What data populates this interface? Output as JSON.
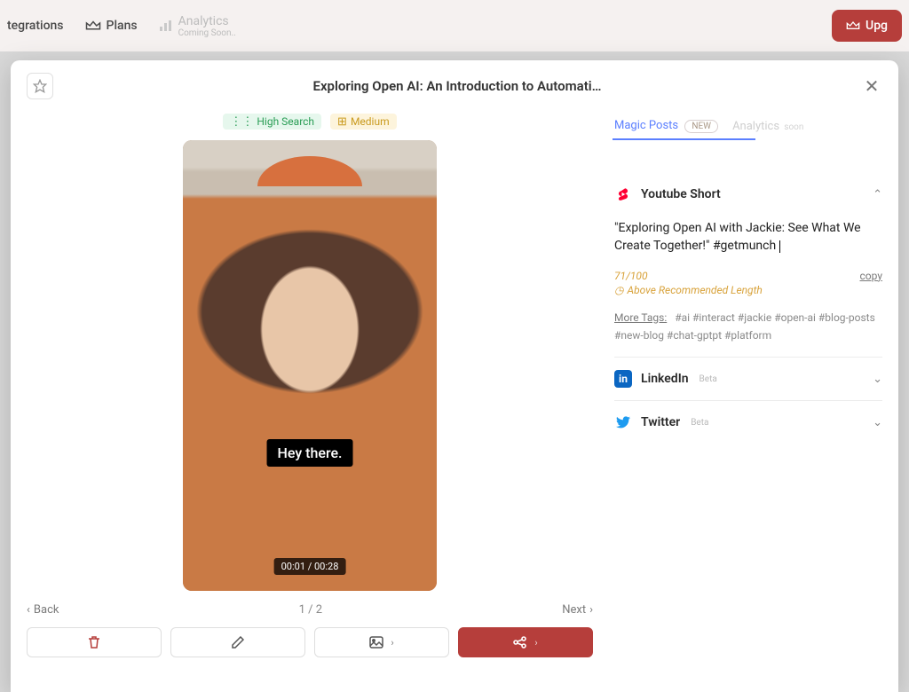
{
  "nav": {
    "integrations": "tegrations",
    "plans": "Plans",
    "analytics": "Analytics",
    "analytics_sub": "Coming Soon..",
    "upgrade": "Upg"
  },
  "modal": {
    "title": "Exploring Open AI: An Introduction to Automati…"
  },
  "badges": {
    "search": "High Search",
    "medium": "Medium"
  },
  "video": {
    "caption": "Hey there.",
    "time": "00:01 / 00:28"
  },
  "pager": {
    "back": "Back",
    "position": "1 / 2",
    "next": "Next"
  },
  "tabs": {
    "magic_posts": "Magic Posts",
    "new_pill": "NEW",
    "analytics": "Analytics",
    "analytics_tag": "soon"
  },
  "youtube": {
    "title": "Youtube Short",
    "post_text": "\"Exploring Open AI with Jackie: See What We Create Together!\" #getmunch",
    "char_count": "71/100",
    "copy": "copy",
    "rec_length": "Above Recommended Length",
    "more_tags_label": "More Tags:",
    "more_tags": "#ai  #interact  #jackie  #open-ai  #blog-posts  #new-blog  #chat-gptpt  #platform"
  },
  "linkedin": {
    "title": "LinkedIn",
    "beta": "Beta"
  },
  "twitter": {
    "title": "Twitter",
    "beta": "Beta"
  }
}
